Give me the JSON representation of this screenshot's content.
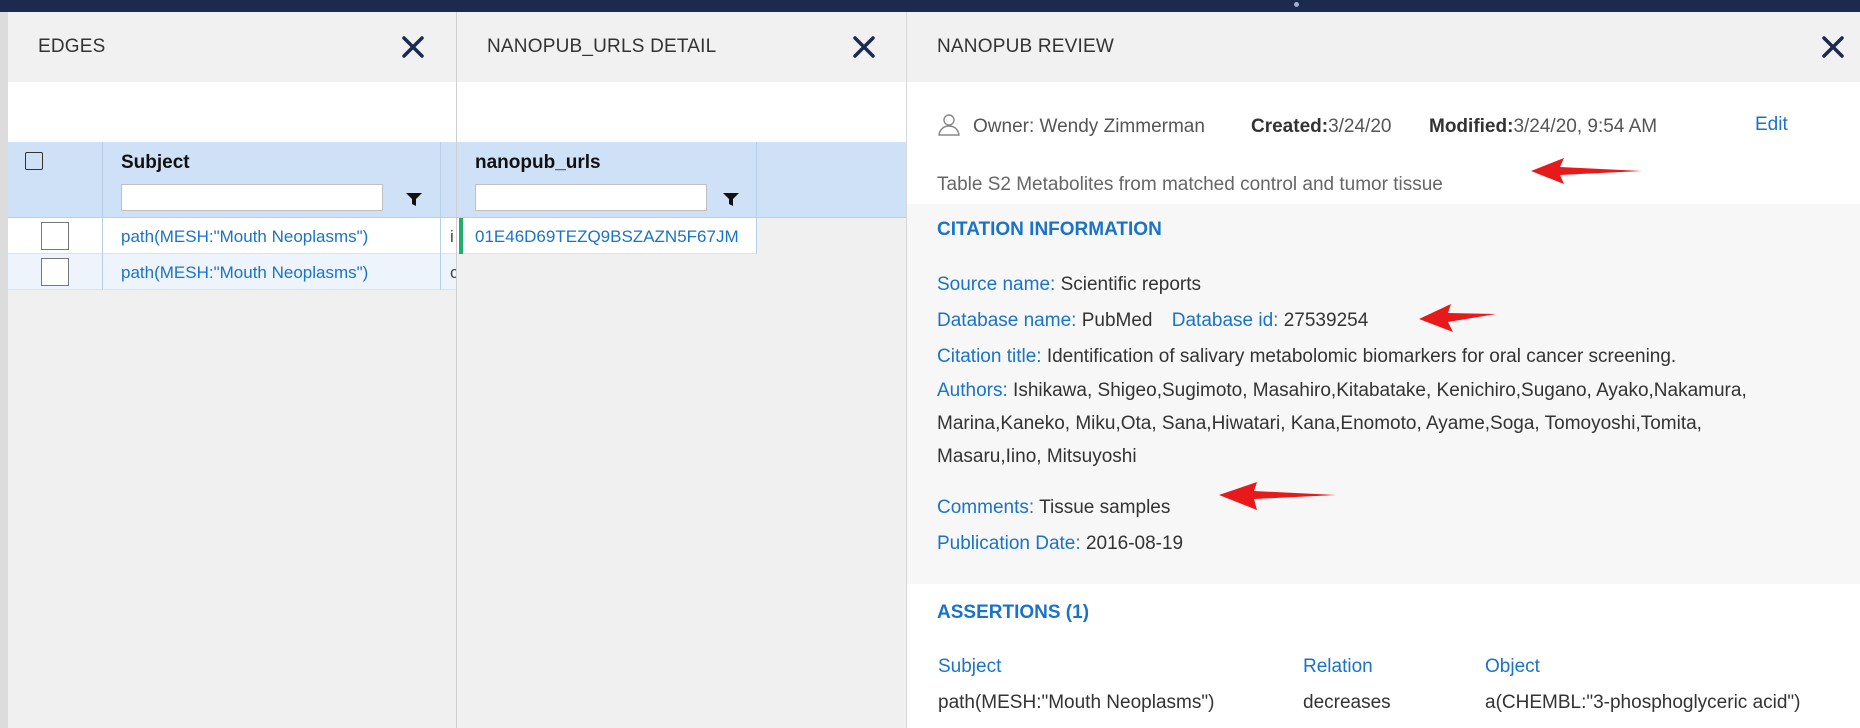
{
  "edges_panel": {
    "title": "EDGES",
    "column_subject": "Subject",
    "rows": [
      {
        "subject": "path(MESH:\"Mouth Neoplasms\")",
        "next_col_peek": "i"
      },
      {
        "subject": "path(MESH:\"Mouth Neoplasms\")",
        "next_col_peek": "c"
      }
    ]
  },
  "urls_panel": {
    "title": "NANOPUB_URLS DETAIL",
    "column_urls": "nanopub_urls",
    "rows": [
      {
        "url": "01E46D69TEZQ9BSZAZN5F67JM"
      }
    ]
  },
  "review_panel": {
    "title": "NANOPUB REVIEW",
    "owner": "Owner: Wendy Zimmerman",
    "created_label": "Created:",
    "created_value": "3/24/20",
    "modified_label": "Modified:",
    "modified_value": "3/24/20, 9:54 AM",
    "edit_label": "Edit",
    "description": "Table S2 Metabolites from matched control and tumor tissue",
    "citation": {
      "section_title": "CITATION INFORMATION",
      "source_name_label": "Source name:",
      "source_name": "Scientific reports",
      "database_name_label": "Database name:",
      "database_name": "PubMed",
      "database_id_label": "Database id:",
      "database_id": "27539254",
      "citation_title_label": "Citation title:",
      "citation_title": "Identification of salivary metabolomic biomarkers for oral cancer screening.",
      "authors_label": "Authors:",
      "authors_line1": "Ishikawa, Shigeo,Sugimoto, Masahiro,Kitabatake, Kenichiro,Sugano, Ayako,Nakamura,",
      "authors_line2": "Marina,Kaneko, Miku,Ota, Sana,Hiwatari, Kana,Enomoto, Ayame,Soga, Tomoyoshi,Tomita,",
      "authors_line3": "Masaru,Iino, Mitsuyoshi",
      "comments_label": "Comments:",
      "comments": "Tissue samples",
      "publication_date_label": "Publication Date:",
      "publication_date": "2016-08-19"
    },
    "assertions": {
      "section_title": "ASSERTIONS (1)",
      "headers": {
        "subject": "Subject",
        "relation": "Relation",
        "object": "Object"
      },
      "rows": [
        {
          "subject": "path(MESH:\"Mouth Neoplasms\")",
          "relation": "decreases",
          "object": "a(CHEMBL:\"3-phosphoglyceric acid\")"
        }
      ]
    }
  },
  "colors": {
    "topbar": "#1d2a4f",
    "link": "#1a73c7",
    "grid_header": "#cfe1f7",
    "annotation_arrow": "#e8191b",
    "row_marker": "#1fae6b"
  }
}
